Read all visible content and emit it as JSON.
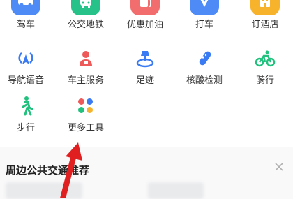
{
  "tools": [
    {
      "label": "驾车",
      "icon": "car-icon",
      "color": "#4e8bf7"
    },
    {
      "label": "公交地铁",
      "icon": "bus-icon",
      "color": "#26c28a"
    },
    {
      "label": "优惠加油",
      "icon": "gas-station-icon",
      "color": "#f26d6d"
    },
    {
      "label": "打车",
      "icon": "taxi-icon",
      "color": "#4e8bf7"
    },
    {
      "label": "订酒店",
      "icon": "hotel-icon",
      "color": "#f7b32b"
    },
    {
      "label": "导航语音",
      "icon": "voice-signal-icon",
      "color": "#3a7af2"
    },
    {
      "label": "车主服务",
      "icon": "driver-icon",
      "color": "#ee5a5a"
    },
    {
      "label": "足迹",
      "icon": "footprint-icon",
      "color": "#3a7af2"
    },
    {
      "label": "核酸检测",
      "icon": "test-tube-icon",
      "color": "#3a7af2"
    },
    {
      "label": "骑行",
      "icon": "bicycle-icon",
      "color": "#22c27e"
    },
    {
      "label": "步行",
      "icon": "walking-icon",
      "color": "#22c27e"
    },
    {
      "label": "更多工具",
      "icon": "more-tools-icon",
      "color": "#ee5a5a"
    }
  ],
  "section": {
    "title": "周边公共交通推荐",
    "close_icon": "close-icon"
  },
  "annotation": {
    "icon": "red-arrow-icon",
    "color": "#e02020"
  }
}
